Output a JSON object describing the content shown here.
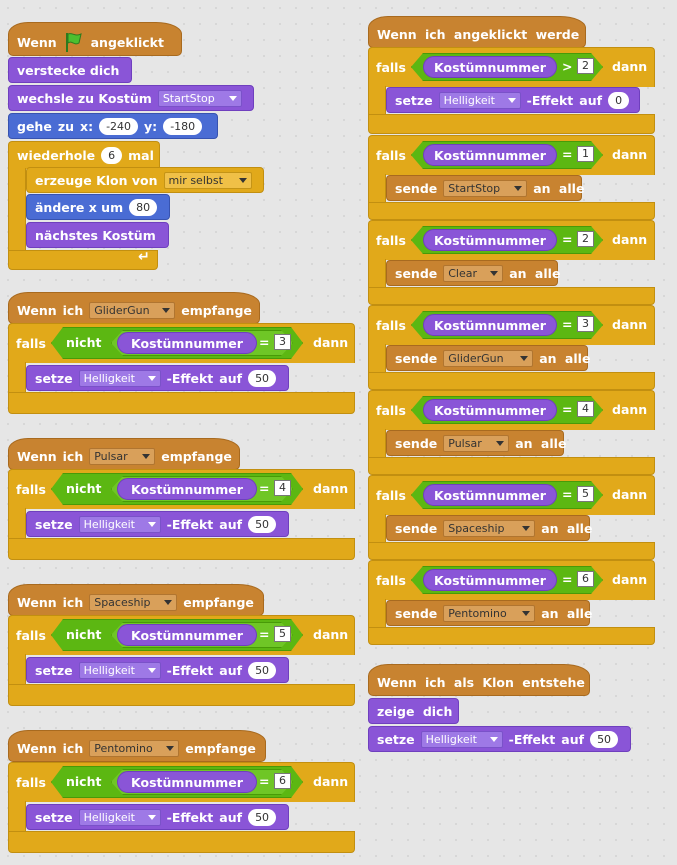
{
  "script1": {
    "hat_when": "Wenn",
    "hat_clicked": "angeklickt",
    "hide": "verstecke dich",
    "switch_costume": "wechsle zu Kostüm",
    "costume_value": "StartStop",
    "goto_go": "gehe",
    "goto_to": "zu",
    "goto_x": "x:",
    "x_value": "-240",
    "goto_y": "y:",
    "y_value": "-180",
    "repeat": "wiederhole",
    "repeat_count": "6",
    "repeat_times": "mal",
    "create_clone": "erzeuge Klon von",
    "clone_target": "mir selbst",
    "change_x": "ändere x um",
    "change_x_value": "80",
    "next_costume": "nächstes Kostüm"
  },
  "receive_scripts": [
    {
      "when": "Wenn",
      "ich": "ich",
      "message": "GliderGun",
      "receive": "empfange",
      "if": "falls",
      "not": "nicht",
      "costume_number": "Kostümnummer",
      "eq": "=",
      "compare": "3",
      "then": "dann",
      "set": "setze",
      "effect": "Helligkeit",
      "effect_suffix": "-Effekt",
      "to": "auf",
      "value": "50"
    },
    {
      "when": "Wenn",
      "ich": "ich",
      "message": "Pulsar",
      "receive": "empfange",
      "if": "falls",
      "not": "nicht",
      "costume_number": "Kostümnummer",
      "eq": "=",
      "compare": "4",
      "then": "dann",
      "set": "setze",
      "effect": "Helligkeit",
      "effect_suffix": "-Effekt",
      "to": "auf",
      "value": "50"
    },
    {
      "when": "Wenn",
      "ich": "ich",
      "message": "Spaceship",
      "receive": "empfange",
      "if": "falls",
      "not": "nicht",
      "costume_number": "Kostümnummer",
      "eq": "=",
      "compare": "5",
      "then": "dann",
      "set": "setze",
      "effect": "Helligkeit",
      "effect_suffix": "-Effekt",
      "to": "auf",
      "value": "50"
    },
    {
      "when": "Wenn",
      "ich": "ich",
      "message": "Pentomino",
      "receive": "empfange",
      "if": "falls",
      "not": "nicht",
      "costume_number": "Kostümnummer",
      "eq": "=",
      "compare": "6",
      "then": "dann",
      "set": "setze",
      "effect": "Helligkeit",
      "effect_suffix": "-Effekt",
      "to": "auf",
      "value": "50"
    }
  ],
  "clicked_script": {
    "hat": "Wenn ich angeklickt werde",
    "first_if": {
      "if": "falls",
      "costume_number": "Kostümnummer",
      "op": ">",
      "compare": "2",
      "then": "dann",
      "set": "setze",
      "effect": "Helligkeit",
      "effect_suffix": "-Effekt",
      "to": "auf",
      "value": "0"
    },
    "ifs": [
      {
        "if": "falls",
        "costume_number": "Kostümnummer",
        "op": "=",
        "compare": "1",
        "then": "dann",
        "send": "sende",
        "message": "StartStop",
        "to_all": "an alle"
      },
      {
        "if": "falls",
        "costume_number": "Kostümnummer",
        "op": "=",
        "compare": "2",
        "then": "dann",
        "send": "sende",
        "message": "Clear",
        "to_all": "an alle"
      },
      {
        "if": "falls",
        "costume_number": "Kostümnummer",
        "op": "=",
        "compare": "3",
        "then": "dann",
        "send": "sende",
        "message": "GliderGun",
        "to_all": "an alle"
      },
      {
        "if": "falls",
        "costume_number": "Kostümnummer",
        "op": "=",
        "compare": "4",
        "then": "dann",
        "send": "sende",
        "message": "Pulsar",
        "to_all": "an alle"
      },
      {
        "if": "falls",
        "costume_number": "Kostümnummer",
        "op": "=",
        "compare": "5",
        "then": "dann",
        "send": "sende",
        "message": "Spaceship",
        "to_all": "an alle"
      },
      {
        "if": "falls",
        "costume_number": "Kostümnummer",
        "op": "=",
        "compare": "6",
        "then": "dann",
        "send": "sende",
        "message": "Pentomino",
        "to_all": "an alle"
      }
    ]
  },
  "clone_script": {
    "hat": "Wenn ich als Klon entstehe",
    "show": "zeige dich",
    "set": "setze",
    "effect": "Helligkeit",
    "effect_suffix": "-Effekt",
    "to": "auf",
    "value": "50"
  },
  "colors": {
    "events": "#c88330",
    "control": "#e1a91a",
    "looks": "#8a55d7",
    "motion": "#4a6cd4",
    "operators": "#5cb712"
  }
}
